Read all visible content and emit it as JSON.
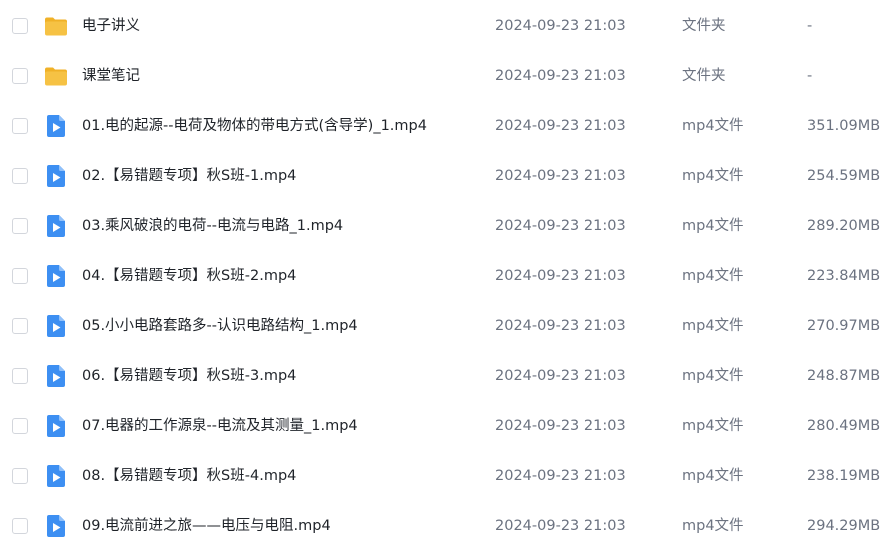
{
  "colors": {
    "folder": "#f6c244",
    "folder_tab": "#f0b127",
    "video": "#3d8ff2",
    "text_primary": "#1f2329",
    "text_secondary": "#6b7280",
    "checkbox_border": "#d3d6dc"
  },
  "files": [
    {
      "name": "电子讲义",
      "date": "2024-09-23 21:03",
      "type": "文件夹",
      "size": "-",
      "icon": "folder-icon"
    },
    {
      "name": "课堂笔记",
      "date": "2024-09-23 21:03",
      "type": "文件夹",
      "size": "-",
      "icon": "folder-icon"
    },
    {
      "name": "01.电的起源--电荷及物体的带电方式(含导学)_1.mp4",
      "date": "2024-09-23 21:03",
      "type": "mp4文件",
      "size": "351.09MB",
      "icon": "video-file-icon"
    },
    {
      "name": "02.【易错题专项】秋S班-1.mp4",
      "date": "2024-09-23 21:03",
      "type": "mp4文件",
      "size": "254.59MB",
      "icon": "video-file-icon"
    },
    {
      "name": "03.乘风破浪的电荷--电流与电路_1.mp4",
      "date": "2024-09-23 21:03",
      "type": "mp4文件",
      "size": "289.20MB",
      "icon": "video-file-icon"
    },
    {
      "name": "04.【易错题专项】秋S班-2.mp4",
      "date": "2024-09-23 21:03",
      "type": "mp4文件",
      "size": "223.84MB",
      "icon": "video-file-icon"
    },
    {
      "name": "05.小小电路套路多--认识电路结构_1.mp4",
      "date": "2024-09-23 21:03",
      "type": "mp4文件",
      "size": "270.97MB",
      "icon": "video-file-icon"
    },
    {
      "name": "06.【易错题专项】秋S班-3.mp4",
      "date": "2024-09-23 21:03",
      "type": "mp4文件",
      "size": "248.87MB",
      "icon": "video-file-icon"
    },
    {
      "name": "07.电器的工作源泉--电流及其测量_1.mp4",
      "date": "2024-09-23 21:03",
      "type": "mp4文件",
      "size": "280.49MB",
      "icon": "video-file-icon"
    },
    {
      "name": "08.【易错题专项】秋S班-4.mp4",
      "date": "2024-09-23 21:03",
      "type": "mp4文件",
      "size": "238.19MB",
      "icon": "video-file-icon"
    },
    {
      "name": "09.电流前进之旅——电压与电阻.mp4",
      "date": "2024-09-23 21:03",
      "type": "mp4文件",
      "size": "294.29MB",
      "icon": "video-file-icon"
    }
  ]
}
